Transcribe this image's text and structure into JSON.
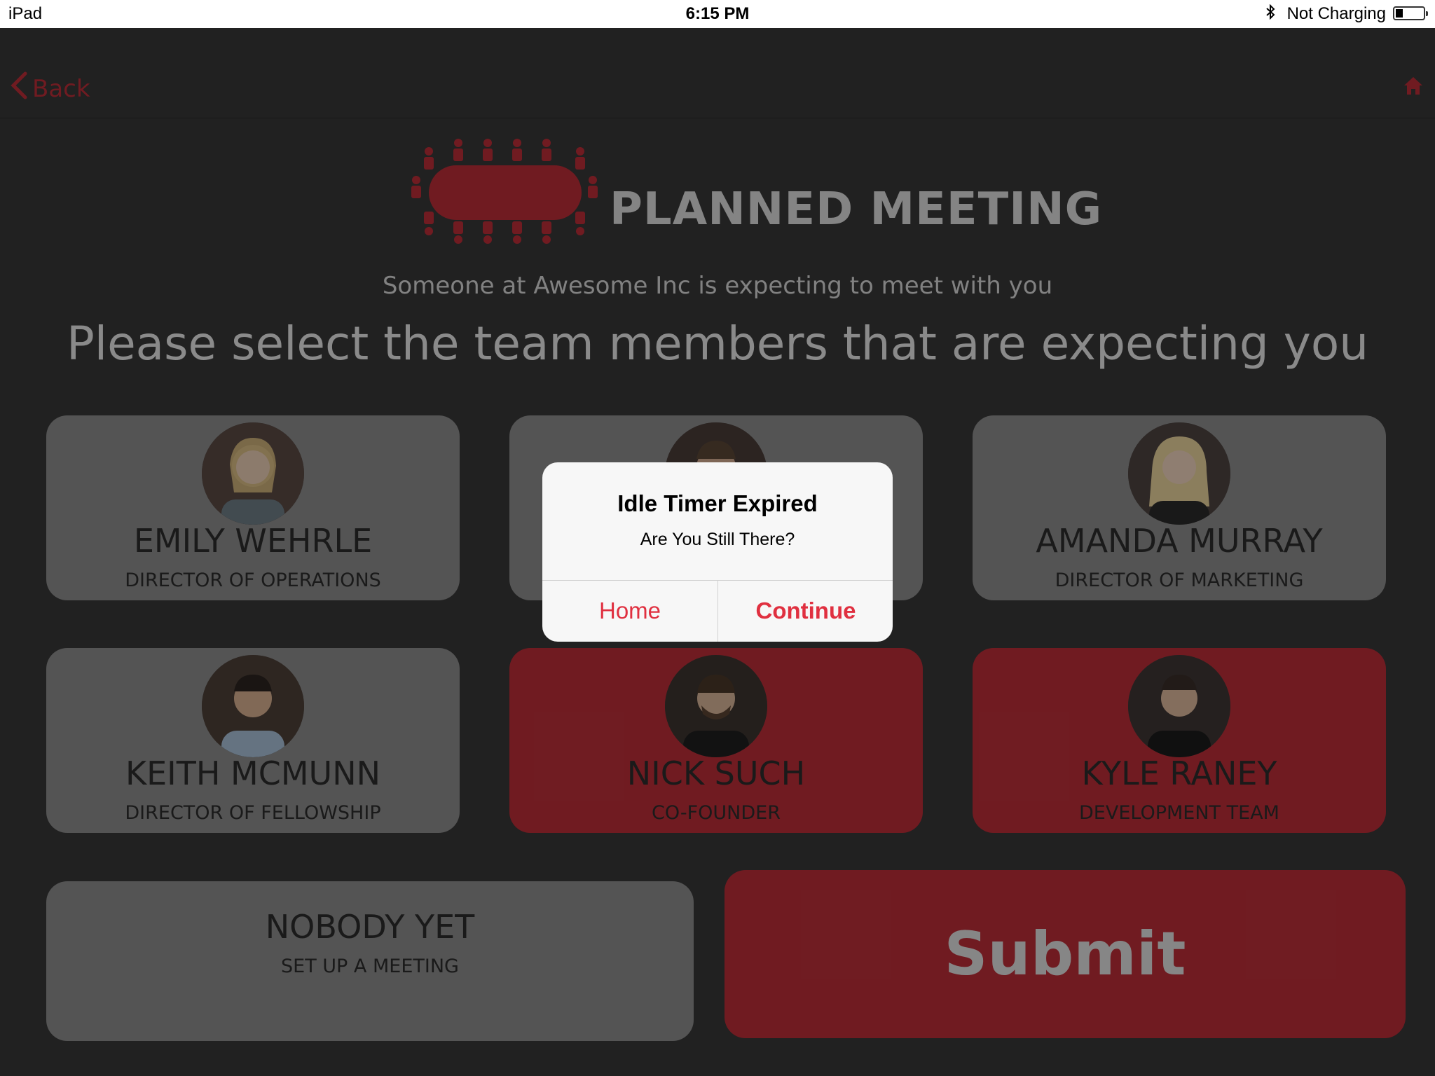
{
  "status_bar": {
    "device": "iPad",
    "time": "6:15 PM",
    "charging": "Not Charging"
  },
  "nav": {
    "back_label": "Back"
  },
  "header": {
    "title": "PLANNED MEETING",
    "subtitle": "Someone at Awesome Inc is expecting to meet with you",
    "headline": "Please select the team members that are expecting you"
  },
  "members": [
    {
      "name": "EMILY WEHRLE",
      "role": "DIRECTOR OF OPERATIONS",
      "selected": false
    },
    {
      "name": "",
      "role": "",
      "selected": false
    },
    {
      "name": "AMANDA MURRAY",
      "role": "DIRECTOR OF MARKETING",
      "selected": false
    },
    {
      "name": "KEITH MCMUNN",
      "role": "DIRECTOR OF FELLOWSHIP",
      "selected": false
    },
    {
      "name": "NICK SUCH",
      "role": "CO-FOUNDER",
      "selected": true
    },
    {
      "name": "KYLE RANEY",
      "role": "DEVELOPMENT TEAM",
      "selected": true
    }
  ],
  "nobody": {
    "name": "NOBODY YET",
    "role": "SET UP A MEETING"
  },
  "submit_label": "Submit",
  "alert": {
    "title": "Idle Timer Expired",
    "message": "Are You Still There?",
    "home_label": "Home",
    "continue_label": "Continue"
  },
  "colors": {
    "accent": "#bb2e38",
    "background": "#373737",
    "card": "#8c8c8c",
    "alert_button": "#e03040"
  }
}
